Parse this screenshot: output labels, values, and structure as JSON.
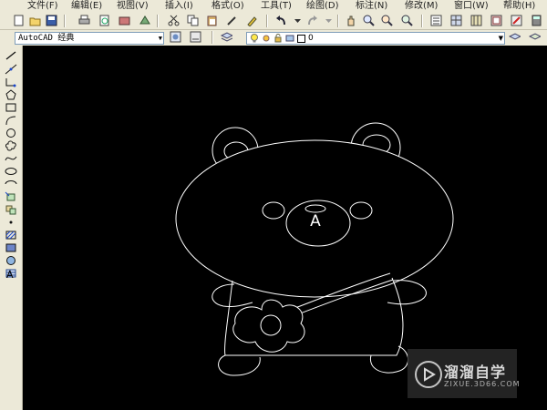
{
  "menubar": {
    "items": [
      {
        "label": "文件(F)"
      },
      {
        "label": "编辑(E)"
      },
      {
        "label": "视图(V)"
      },
      {
        "label": "插入(I)"
      },
      {
        "label": "格式(O)"
      },
      {
        "label": "工具(T)"
      },
      {
        "label": "绘图(D)"
      },
      {
        "label": "标注(N)"
      },
      {
        "label": "修改(M)"
      },
      {
        "label": "窗口(W)"
      },
      {
        "label": "帮助(H)"
      }
    ]
  },
  "toolbar": {
    "text_style": "AutoCAD 经典",
    "layer": "0"
  },
  "draw_toolbar": {
    "text_tool": "A"
  },
  "canvas": {
    "drawing_label": "A"
  },
  "watermark": {
    "brand": "溜溜自学",
    "site": "ZIXUE.3D66.COM"
  }
}
